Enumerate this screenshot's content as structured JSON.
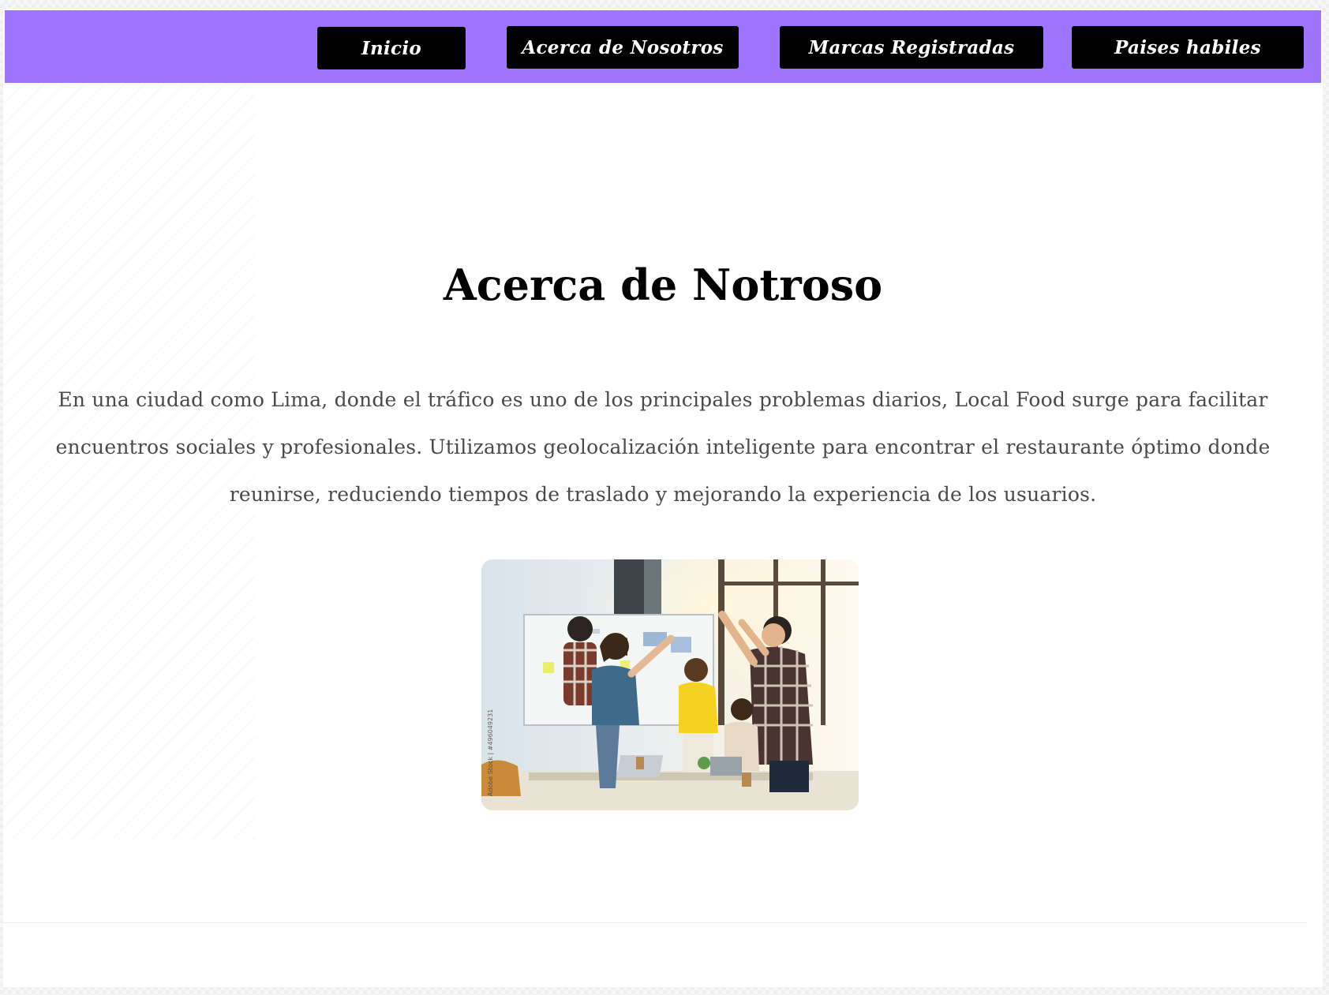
{
  "nav": {
    "items": [
      {
        "label": "Inicio"
      },
      {
        "label": "Acerca de Nosotros"
      },
      {
        "label": "Marcas Registradas"
      },
      {
        "label": "Paises habiles"
      }
    ]
  },
  "main": {
    "title": "Acerca de Notroso",
    "description": "En una ciudad como Lima, donde el tráfico es uno de los principales problemas diarios, Local Food surge para facilitar encuentros sociales y profesionales. Utilizamos geolocalización inteligente para encontrar el restaurante óptimo donde reunirse, reduciendo tiempos de traslado y mejorando la experiencia de los usuarios.",
    "image": {
      "watermark": "Adobe Stock | #496049231"
    }
  },
  "colors": {
    "navbar": "#9f75ff",
    "nav_button": "#000000",
    "nav_text": "#ffffff",
    "title": "#000000",
    "body_text": "#4a4a4a"
  }
}
